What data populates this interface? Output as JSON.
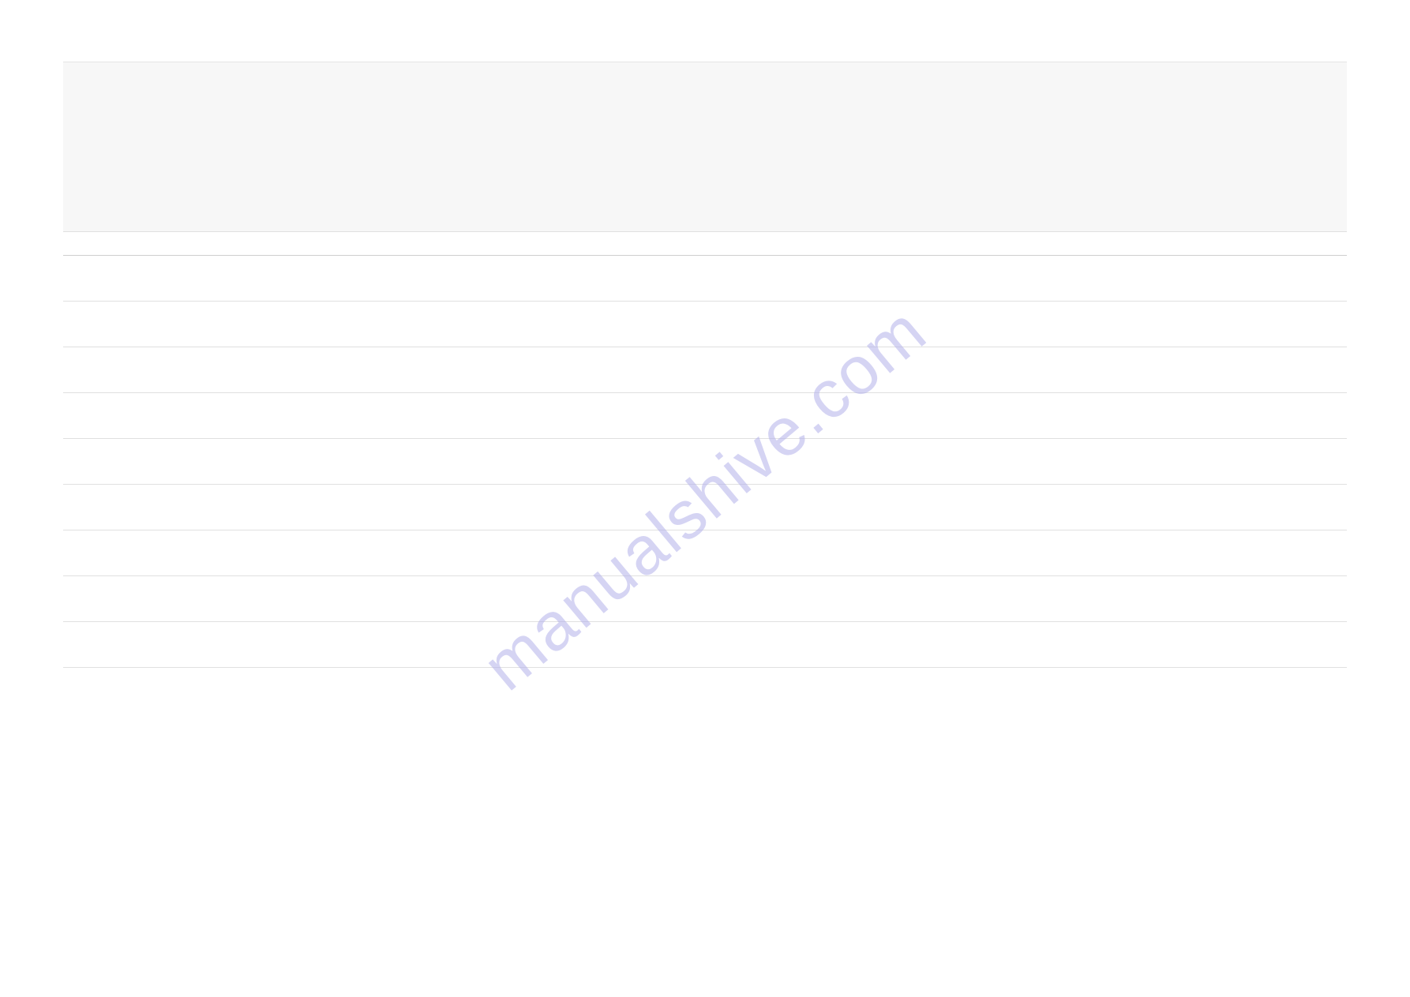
{
  "watermark": {
    "text": "manualshive.com"
  },
  "lines": {
    "count": 10
  }
}
